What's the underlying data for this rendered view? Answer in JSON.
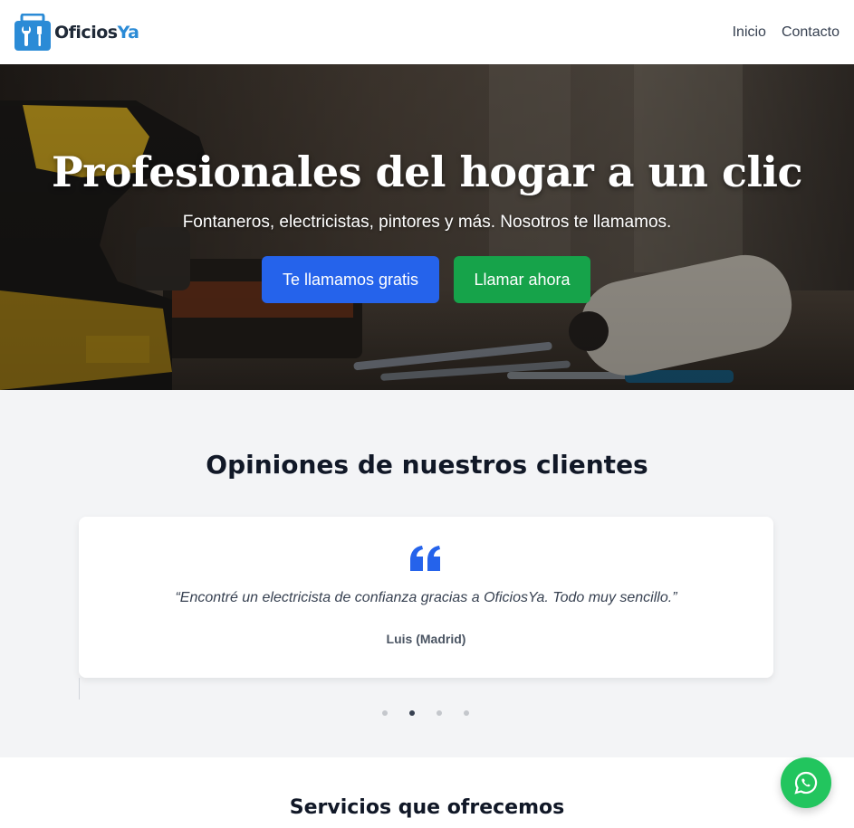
{
  "brand": {
    "name_part1": "Oficios",
    "name_part2": "Ya",
    "logo_icon": "toolbox-icon",
    "accent": "#2b8bd6"
  },
  "nav": {
    "items": [
      {
        "label": "Inicio"
      },
      {
        "label": "Contacto"
      }
    ]
  },
  "hero": {
    "title": "Profesionales del hogar a un clic",
    "subtitle": "Fontaneros, electricistas, pintores y más. Nosotros te llamamos.",
    "primary_button": "Te llamamos gratis",
    "secondary_button": "Llamar ahora",
    "primary_color": "#2563eb",
    "secondary_color": "#16a34a"
  },
  "reviews": {
    "title": "Opiniones de nuestros clientes",
    "quote_icon": "quote-icon",
    "quote": "“Encontré un electricista de confianza gracias a OficiosYa. Todo muy sencillo.”",
    "author": "Luis (Madrid)",
    "dots_total": 4,
    "active_dot": 2
  },
  "services": {
    "title": "Servicios que ofrecemos"
  },
  "whatsapp": {
    "icon": "whatsapp-icon",
    "color": "#22c55e"
  }
}
